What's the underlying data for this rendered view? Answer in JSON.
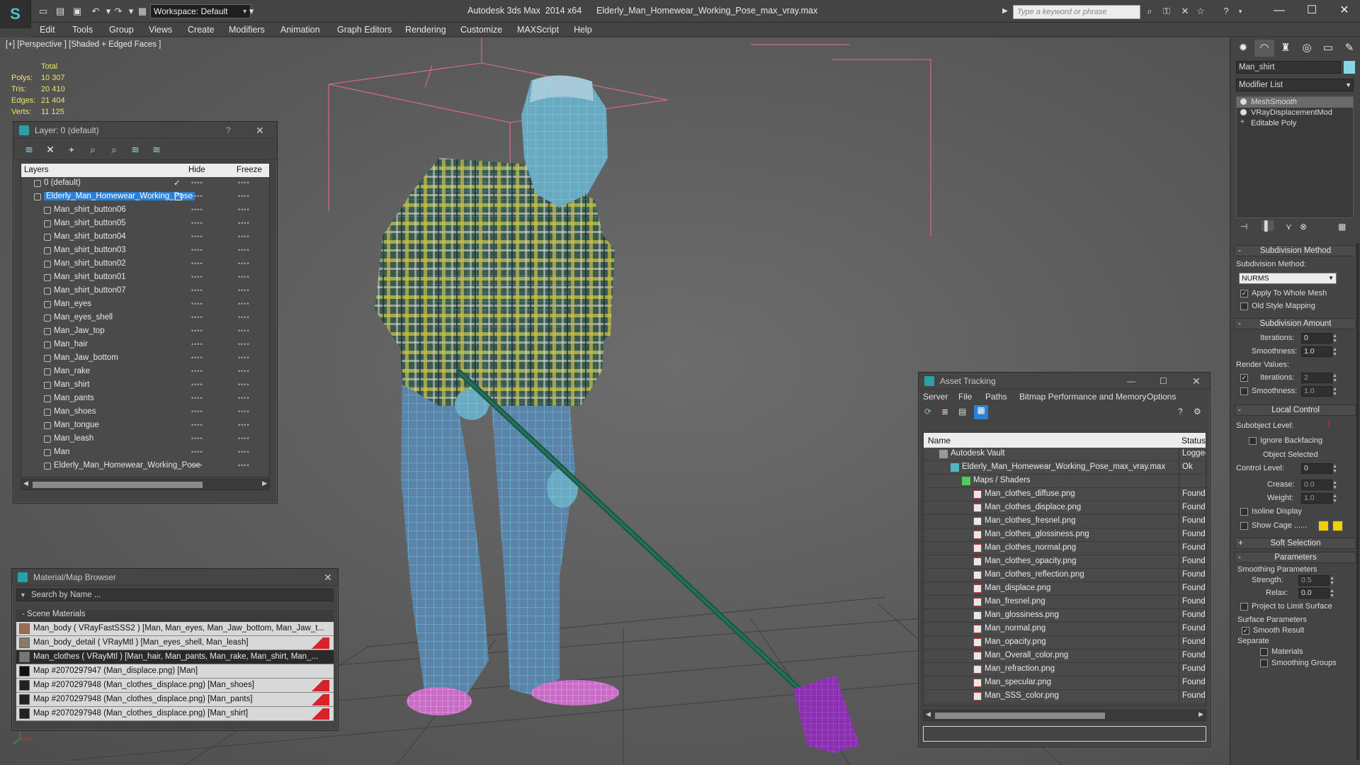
{
  "titlebar": {
    "workspace": "Workspace: Default",
    "title": "Autodesk 3ds Max  2014 x64      Elderly_Man_Homewear_Working_Pose_max_vray.max",
    "search_placeholder": "Type a keyword or phrase"
  },
  "menu": [
    "Edit",
    "Tools",
    "Group",
    "Views",
    "Create",
    "Modifiers",
    "Animation",
    "Graph Editors",
    "Rendering",
    "Customize",
    "MAXScript",
    "Help"
  ],
  "viewport": {
    "label": "[+] [Perspective ] [Shaded + Edged Faces ]",
    "stats_header": "Total",
    "stats": [
      {
        "k": "Polys:",
        "v": "10 307"
      },
      {
        "k": "Tris:",
        "v": "20 410"
      },
      {
        "k": "Edges:",
        "v": "21 404"
      },
      {
        "k": "Verts:",
        "v": "11 125"
      }
    ]
  },
  "layer_panel": {
    "title": "Layer: 0 (default)",
    "help": "?",
    "col_layers": "Layers",
    "col_hide": "Hide",
    "col_freeze": "Freeze",
    "rows": [
      {
        "name": "0 (default)",
        "level": 1,
        "checked": true
      },
      {
        "name": "Elderly_Man_Homewear_Working_Pose",
        "level": 1,
        "selected": true
      },
      {
        "name": "Man_shirt_button06",
        "level": 2
      },
      {
        "name": "Man_shirt_button05",
        "level": 2
      },
      {
        "name": "Man_shirt_button04",
        "level": 2
      },
      {
        "name": "Man_shirt_button03",
        "level": 2
      },
      {
        "name": "Man_shirt_button02",
        "level": 2
      },
      {
        "name": "Man_shirt_button01",
        "level": 2
      },
      {
        "name": "Man_shirt_button07",
        "level": 2
      },
      {
        "name": "Man_eyes",
        "level": 2
      },
      {
        "name": "Man_eyes_shell",
        "level": 2
      },
      {
        "name": "Man_Jaw_top",
        "level": 2
      },
      {
        "name": "Man_hair",
        "level": 2
      },
      {
        "name": "Man_Jaw_bottom",
        "level": 2
      },
      {
        "name": "Man_rake",
        "level": 2
      },
      {
        "name": "Man_shirt",
        "level": 2
      },
      {
        "name": "Man_pants",
        "level": 2
      },
      {
        "name": "Man_shoes",
        "level": 2
      },
      {
        "name": "Man_tongue",
        "level": 2
      },
      {
        "name": "Man_leash",
        "level": 2
      },
      {
        "name": "Man",
        "level": 2
      },
      {
        "name": "Elderly_Man_Homewear_Working_Pose",
        "level": 2
      }
    ]
  },
  "material_browser": {
    "title": "Material/Map Browser",
    "search_placeholder": "Search by Name ...",
    "group": "- Scene Materials",
    "rows": [
      {
        "text": "Man_body  ( VRayFastSSS2 ) [Man, Man_eyes, Man_Jaw_bottom, Man_Jaw_t...",
        "flag": false,
        "dark": false,
        "swatch": "#a06a55"
      },
      {
        "text": "Man_body_detail  ( VRayMtl ) [Man_eyes_shell, Man_leash]",
        "flag": true,
        "dark": false,
        "swatch": "#8a7a6a"
      },
      {
        "text": "Man_clothes  ( VRayMtl ) [Man_hair, Man_pants, Man_rake, Man_shirt, Man_...",
        "flag": false,
        "dark": true,
        "swatch": "#777777"
      },
      {
        "text": "Map #2070297947 (Man_displace.png) [Man]",
        "flag": false,
        "dark": false,
        "swatch": "#111111"
      },
      {
        "text": "Map #2070297948 (Man_clothes_displace.png) [Man_shoes]",
        "flag": true,
        "dark": false,
        "swatch": "#222222"
      },
      {
        "text": "Map #2070297948 (Man_clothes_displace.png) [Man_pants]",
        "flag": true,
        "dark": false,
        "swatch": "#222222"
      },
      {
        "text": "Map #2070297948 (Man_clothes_displace.png) [Man_shirt]",
        "flag": true,
        "dark": false,
        "swatch": "#222222"
      }
    ]
  },
  "asset_tracking": {
    "title": "Asset Tracking",
    "menu": [
      "Server",
      "File",
      "Paths",
      "Bitmap Performance and Memory",
      "Options"
    ],
    "col_name": "Name",
    "col_status": "Status",
    "rows": [
      {
        "name": "Autodesk Vault",
        "status": "Logged",
        "indent": 1,
        "icon": "vault"
      },
      {
        "name": "Elderly_Man_Homewear_Working_Pose_max_vray.max",
        "status": "Ok",
        "indent": 2,
        "icon": "max"
      },
      {
        "name": "Maps / Shaders",
        "status": "",
        "indent": 3,
        "icon": "maps"
      },
      {
        "name": "Man_clothes_diffuse.png",
        "status": "Found",
        "indent": 4,
        "icon": "png"
      },
      {
        "name": "Man_clothes_displace.png",
        "status": "Found",
        "indent": 4,
        "icon": "png"
      },
      {
        "name": "Man_clothes_fresnel.png",
        "status": "Found",
        "indent": 4,
        "icon": "png"
      },
      {
        "name": "Man_clothes_glossiness.png",
        "status": "Found",
        "indent": 4,
        "icon": "png"
      },
      {
        "name": "Man_clothes_normal.png",
        "status": "Found",
        "indent": 4,
        "icon": "png"
      },
      {
        "name": "Man_clothes_opacity.png",
        "status": "Found",
        "indent": 4,
        "icon": "png"
      },
      {
        "name": "Man_clothes_reflection.png",
        "status": "Found",
        "indent": 4,
        "icon": "png"
      },
      {
        "name": "Man_displace.png",
        "status": "Found",
        "indent": 4,
        "icon": "png"
      },
      {
        "name": "Man_fresnel.png",
        "status": "Found",
        "indent": 4,
        "icon": "png"
      },
      {
        "name": "Man_glossiness.png",
        "status": "Found",
        "indent": 4,
        "icon": "png"
      },
      {
        "name": "Man_normal.png",
        "status": "Found",
        "indent": 4,
        "icon": "png"
      },
      {
        "name": "Man_opacity.png",
        "status": "Found",
        "indent": 4,
        "icon": "png"
      },
      {
        "name": "Man_Overall_color.png",
        "status": "Found",
        "indent": 4,
        "icon": "png"
      },
      {
        "name": "Man_refraction.png",
        "status": "Found",
        "indent": 4,
        "icon": "png"
      },
      {
        "name": "Man_specular.png",
        "status": "Found",
        "indent": 4,
        "icon": "png"
      },
      {
        "name": "Man_SSS_color.png",
        "status": "Found",
        "indent": 4,
        "icon": "png"
      }
    ]
  },
  "command_panel": {
    "object_name": "Man_shirt",
    "object_color": "#87d5e6",
    "modifier_list": "Modifier List",
    "stack": [
      {
        "name": "MeshSmooth",
        "selected": true,
        "italic": true
      },
      {
        "name": "VRayDisplacementMod",
        "selected": false,
        "italic": false
      },
      {
        "name": "Editable Poly",
        "selected": false,
        "italic": false
      }
    ],
    "subdivision_method": {
      "head": "Subdivision Method",
      "label": "Subdivision Method:",
      "value": "NURMS",
      "apply_whole": "Apply To Whole Mesh",
      "old_style": "Old Style Mapping"
    },
    "subdivision_amount": {
      "head": "Subdivision Amount",
      "iterations_label": "Iterations:",
      "iterations": "0",
      "smoothness_label": "Smoothness:",
      "smoothness": "1.0",
      "render_values": "Render Values:",
      "r_iterations_label": "Iterations:",
      "r_iterations": "2",
      "r_smoothness_label": "Smoothness:",
      "r_smoothness": "1.0"
    },
    "local_control": {
      "head": "Local Control",
      "subobject_label": "Subobject Level:",
      "ignore_backfacing": "Ignore Backfacing",
      "object_selected": "Object Selected",
      "control_level_label": "Control Level:",
      "control_level": "0",
      "crease_label": "Crease:",
      "crease": "0.0",
      "weight_label": "Weight:",
      "weight": "1.0",
      "isoline": "Isoline Display",
      "show_cage": "Show Cage ......"
    },
    "soft_selection": {
      "head": "Soft Selection"
    },
    "parameters": {
      "head": "Parameters",
      "smoothing_params": "Smoothing Parameters",
      "strength_label": "Strength:",
      "strength": "0.5",
      "relax_label": "Relax:",
      "relax": "0.0",
      "project_limit": "Project to Limit Surface",
      "surface_params": "Surface Parameters",
      "smooth_result": "Smooth Result",
      "separate": "Separate",
      "materials": "Materials",
      "smoothing_groups": "Smoothing Groups"
    }
  }
}
